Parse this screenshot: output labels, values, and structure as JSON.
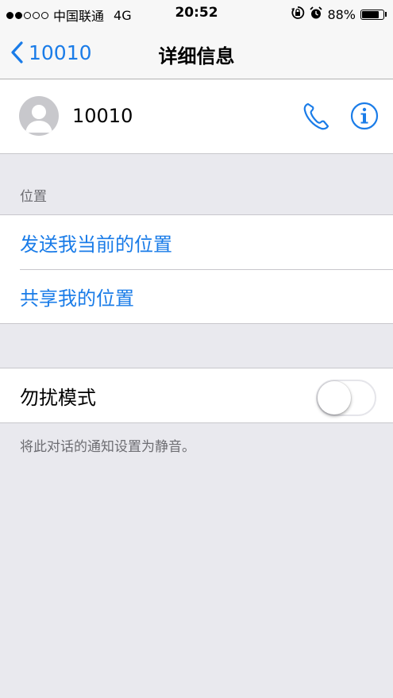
{
  "status_bar": {
    "signal_filled": 2,
    "signal_total": 5,
    "carrier": "中国联通",
    "network": "4G",
    "time": "20:52",
    "battery_percent": "88%",
    "battery_level": 0.88
  },
  "nav": {
    "back_label": "10010",
    "title": "详细信息"
  },
  "contact": {
    "name": "10010"
  },
  "location_section": {
    "header": "位置",
    "items": [
      {
        "label": "发送我当前的位置"
      },
      {
        "label": "共享我的位置"
      }
    ]
  },
  "dnd": {
    "label": "勿扰模式",
    "enabled": false,
    "footer": "将此对话的通知设置为静音。"
  },
  "colors": {
    "accent": "#1a7ce8",
    "background": "#e9e9ee"
  }
}
